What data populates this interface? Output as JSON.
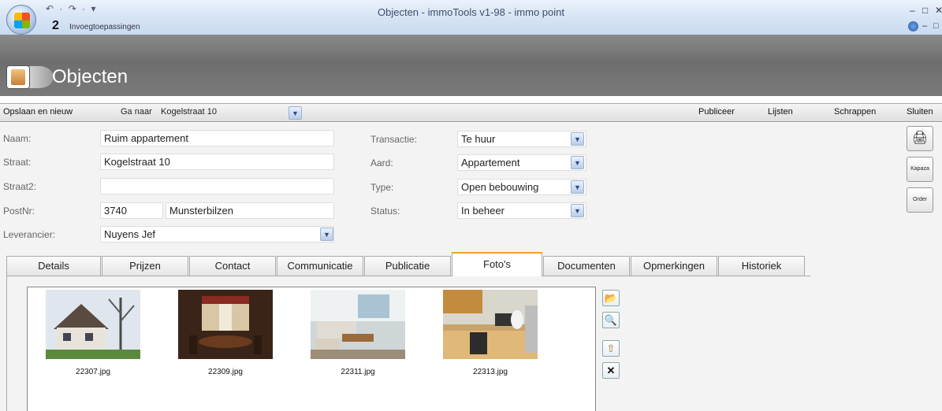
{
  "window": {
    "title": "Objecten - immoTools  v1-98 - immo point",
    "quick_access": "↶ · ↷ · ▾",
    "step": "2",
    "ribbon_tab": "Invoegtoepassingen",
    "controls": [
      "–",
      "□",
      "✕"
    ]
  },
  "header": {
    "title": "Objecten"
  },
  "commands": {
    "save_new": "Opslaan en nieuw",
    "goto_label": "Ga naar",
    "goto_value": "Kogelstraat 10",
    "publish": "Publiceer",
    "lists": "Lijsten",
    "delete": "Schrappen",
    "close": "Sluiten"
  },
  "form": {
    "naam_label": "Naam:",
    "naam": "Ruim appartement",
    "straat_label": "Straat:",
    "straat": "Kogelstraat 10",
    "straat2_label": "Straat2:",
    "straat2": "",
    "postnr_label": "PostNr:",
    "postnr": "3740",
    "gemeente": "Munsterbilzen",
    "leverancier_label": "Leverancier:",
    "leverancier": "Nuyens Jef",
    "transactie_label": "Transactie:",
    "transactie": "Te huur",
    "aard_label": "Aard:",
    "aard": "Appartement",
    "type_label": "Type:",
    "type": "Open bebouwing",
    "status_label": "Status:",
    "status": "In beheer"
  },
  "side_buttons": {
    "print": "🖨",
    "kapaza": "Kapaza",
    "order": "Order"
  },
  "tabs": [
    "Details",
    "Prijzen",
    "Contact",
    "Communicatie",
    "Publicatie",
    "Foto's",
    "Documenten",
    "Opmerkingen",
    "Historiek"
  ],
  "active_tab": "Foto's",
  "photos": [
    {
      "file": "22307.jpg",
      "scene": "house-exterior"
    },
    {
      "file": "22309.jpg",
      "scene": "dining-room"
    },
    {
      "file": "22311.jpg",
      "scene": "living-room"
    },
    {
      "file": "22313.jpg",
      "scene": "kitchen"
    }
  ],
  "photo_tools": [
    "open-folder-icon",
    "zoom-icon",
    "export-icon",
    "delete-icon"
  ],
  "colors": {
    "header_bg": "#7a7a7a",
    "active_tab_accent": "#f0a030",
    "titlebar": "#d6e4f5"
  }
}
